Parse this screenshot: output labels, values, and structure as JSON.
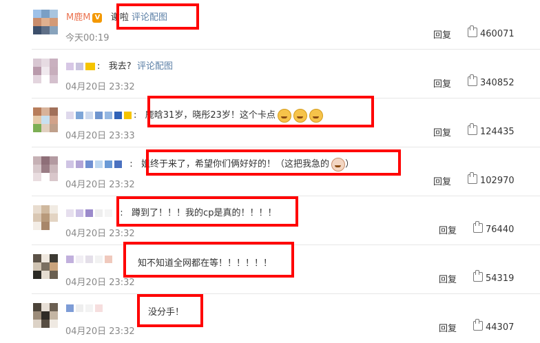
{
  "comments": [
    {
      "user": "M鹿M",
      "text": "谢啦",
      "link": "评论配图",
      "time": "今天00:19",
      "reply": "回复",
      "likes": "460071"
    },
    {
      "text": "我去?",
      "link": "评论配图",
      "time": "04月20日 23:32",
      "reply": "回复",
      "likes": "340852"
    },
    {
      "text": "鹿晗31岁，晓彤23岁！这个卡点",
      "time": "04月20日 23:33",
      "reply": "回复",
      "likes": "124435"
    },
    {
      "text": "姐终于来了，希望你们俩好好的！（这把我急的",
      "text_end": "）",
      "time": "04月20日 23:32",
      "reply": "回复",
      "likes": "102970"
    },
    {
      "text": "蹲到了！！！我的cp是真的！！！！",
      "time": "04月20日 23:32",
      "reply": "回复",
      "likes": "76440"
    },
    {
      "text": "知不知道全网都在等！！！！！！",
      "time": "04月20日 23:32",
      "reply": "回复",
      "likes": "54319"
    },
    {
      "text": "没分手！",
      "time": "04月20日 23:32",
      "reply": "回复",
      "likes": "44307"
    }
  ],
  "colors": {
    "highlight_box": "#ff0000",
    "username": "#eb7350",
    "link": "#5b7fa6",
    "meta": "#888888"
  },
  "icons": [
    "thumbs-up-icon",
    "verified-badge-icon",
    "crying-emoji-icon"
  ]
}
